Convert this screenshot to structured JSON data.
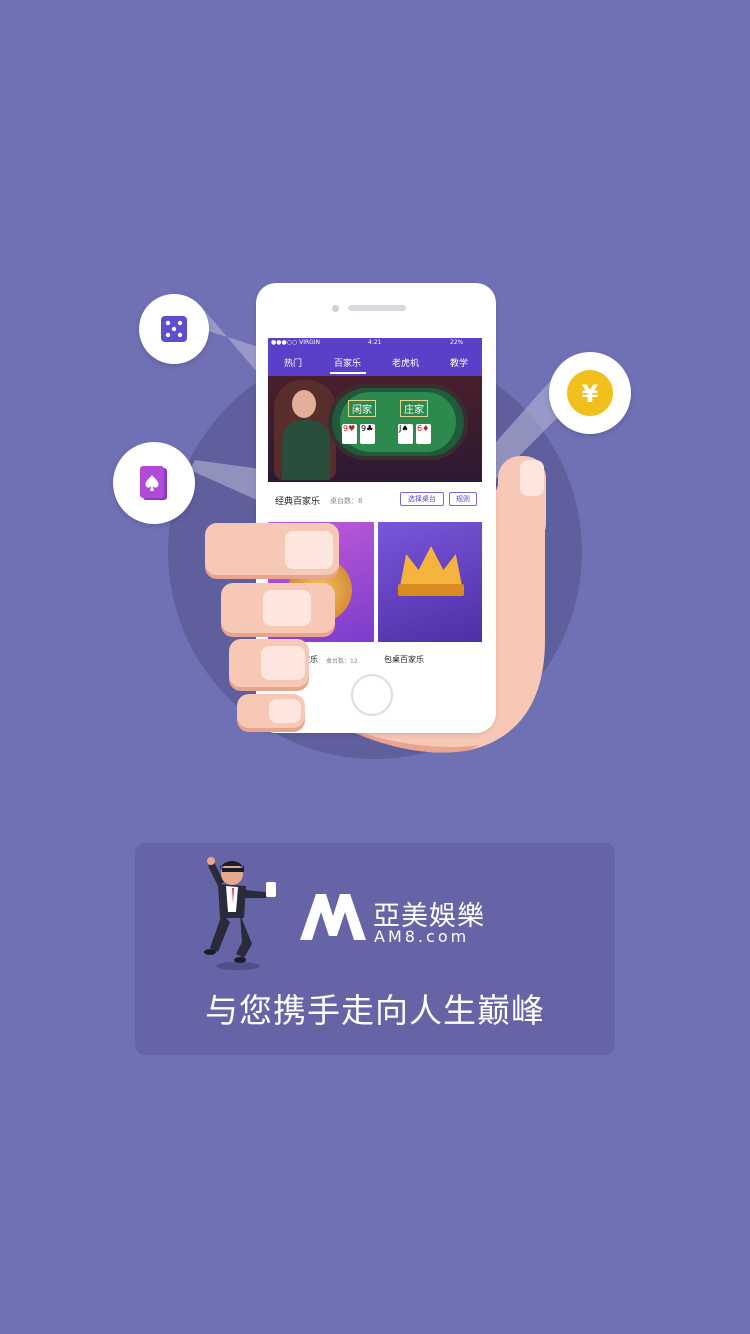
{
  "colors": {
    "background": "#7071b5",
    "accent": "#5b3fc8",
    "panel": "#6564a7",
    "coin_gold": "#f2c01c",
    "card_purple": "#b14ad8",
    "dice_purple": "#5b4ed0"
  },
  "icons": {
    "dice": "dice-icon",
    "spade_card": "spade-card-icon",
    "yuan": "yuan-coin-icon"
  },
  "phone": {
    "status": {
      "carrier": "●●●○○ VIRGIN",
      "time": "4:21",
      "battery": "22%"
    },
    "tabs": [
      "热门",
      "百家乐",
      "老虎机",
      "教学"
    ],
    "selected_tab": "百家乐",
    "banner": {
      "player_label": "闲家",
      "banker_label": "庄家"
    },
    "game": {
      "title": "经典百家乐",
      "count": "桌台数：8",
      "select_button": "选择桌台",
      "rules_button": "规则"
    },
    "tiles": [
      {
        "title": "家乐",
        "count": "桌台数：12"
      },
      {
        "title": "包桌百家乐"
      }
    ]
  },
  "brand": {
    "logo_letter": "M",
    "name_cn": "亞美娛樂",
    "domain": "AM8.com"
  },
  "slogan": "与您携手走向人生巅峰"
}
